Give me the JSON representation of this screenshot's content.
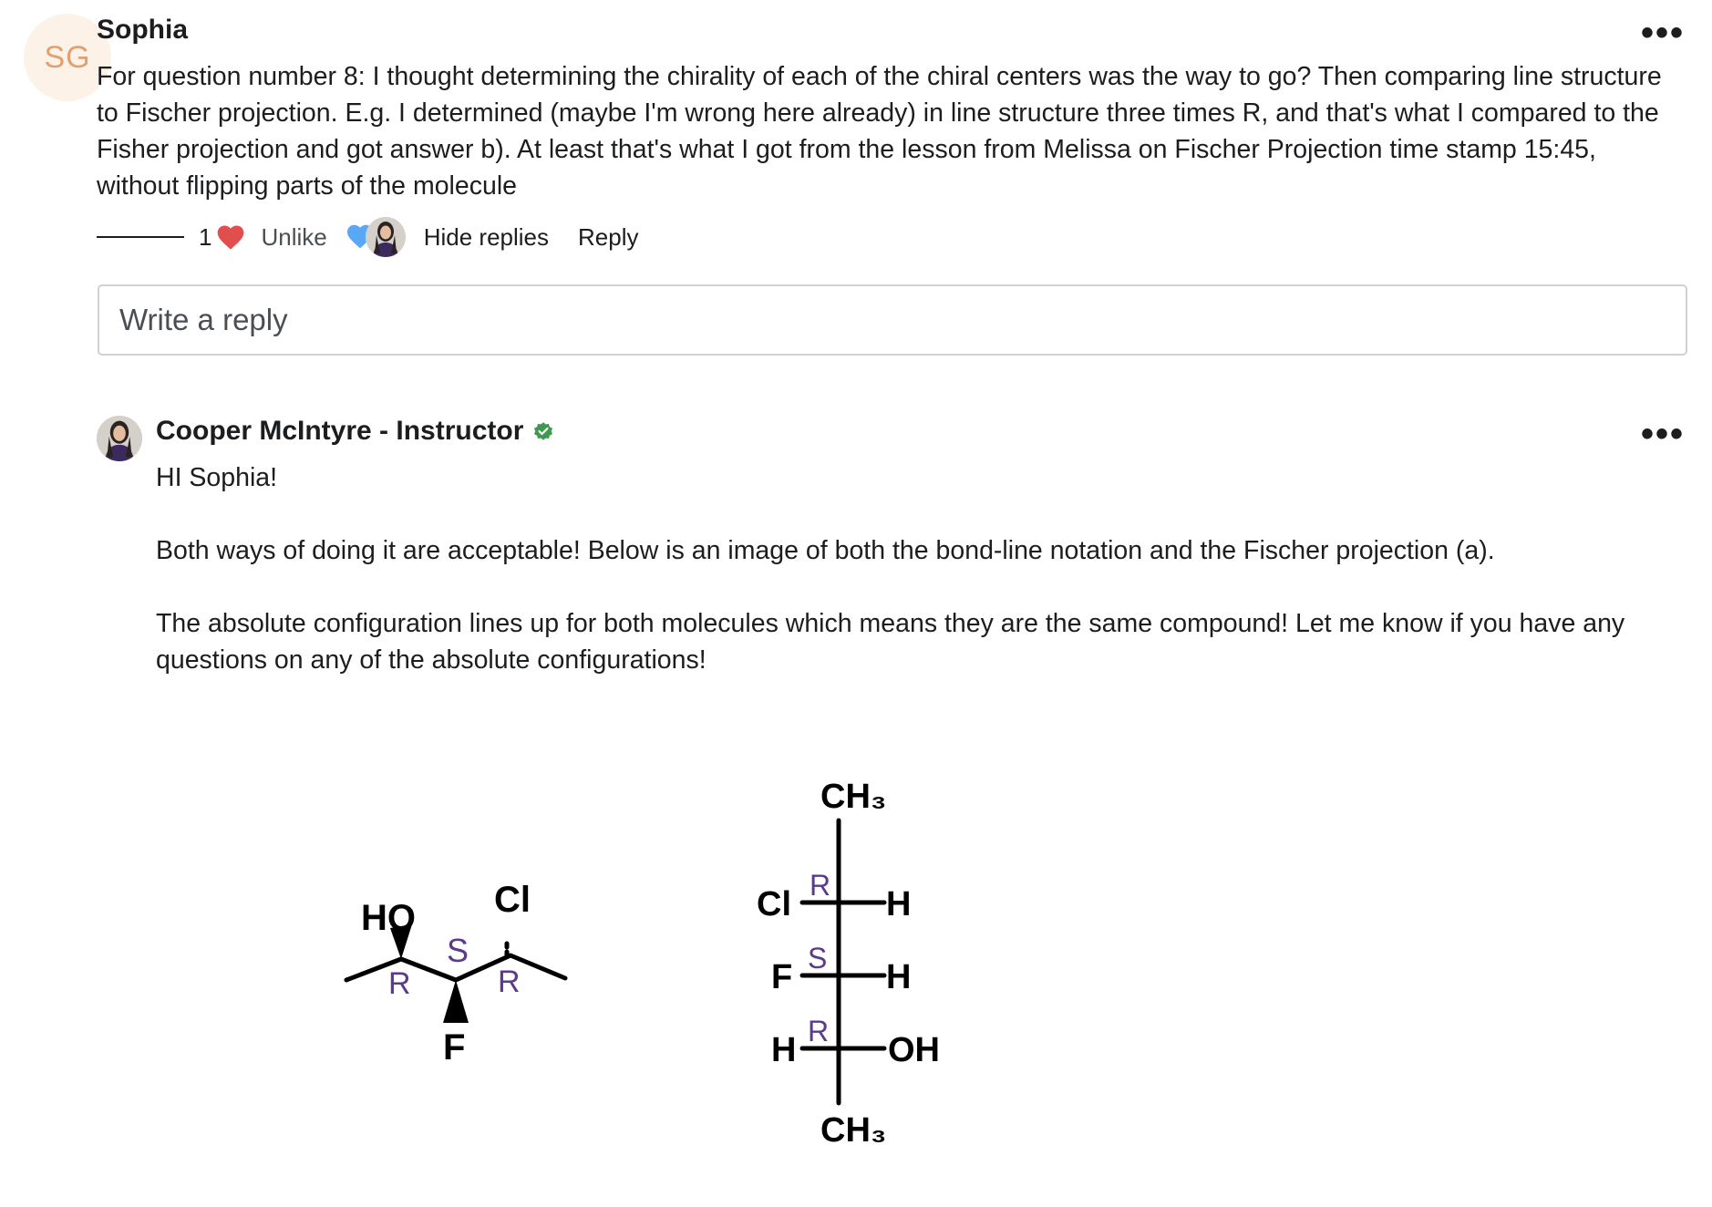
{
  "comment": {
    "avatar_initials": "SG",
    "author": "Sophia",
    "more_label": "•••",
    "text": "For question number 8: I thought determining the chirality of each of the chiral centers was the way to go? Then comparing line structure to Fischer projection. E.g. I determined (maybe I'm wrong here already) in line structure three times R, and that's what I compared to the Fisher projection and got answer b). At least that's what I got from the lesson from Melissa on Fischer Projection time stamp 15:45, without flipping parts of the molecule",
    "like_count": "1",
    "unlike_label": "Unlike",
    "hide_replies_label": "Hide replies",
    "reply_label": "Reply"
  },
  "reply_box": {
    "placeholder": "Write a reply"
  },
  "reply": {
    "author": "Cooper McIntyre - Instructor",
    "more_label": "•••",
    "greeting": "HI Sophia!",
    "paragraph_1": "Both ways of doing it are acceptable! Below is an image of both the bond-line notation and the Fischer projection (a).",
    "paragraph_2": "The absolute configuration lines up for both molecules which means they are the same compound! Let me know if you have any questions on any of the absolute configurations!"
  },
  "diagram": {
    "bond_line": {
      "labels": [
        "HO",
        "Cl",
        "F"
      ],
      "configurations": [
        "R",
        "S",
        "R"
      ]
    },
    "fischer": {
      "top": "CH₃",
      "bottom": "CH₃",
      "rows": [
        {
          "left": "Cl",
          "right": "H",
          "config": "R"
        },
        {
          "left": "F",
          "right": "H",
          "config": "S"
        },
        {
          "left": "H",
          "right": "OH",
          "config": "R"
        }
      ]
    },
    "config_color": "#5b3a8c"
  },
  "colors": {
    "like_heart": "#e04e4e",
    "reaction_heart": "#5aa8f5",
    "verified_badge": "#3f9a4f"
  },
  "icons": [
    "heart-icon",
    "blue-heart-icon",
    "verified-icon",
    "more-icon"
  ]
}
